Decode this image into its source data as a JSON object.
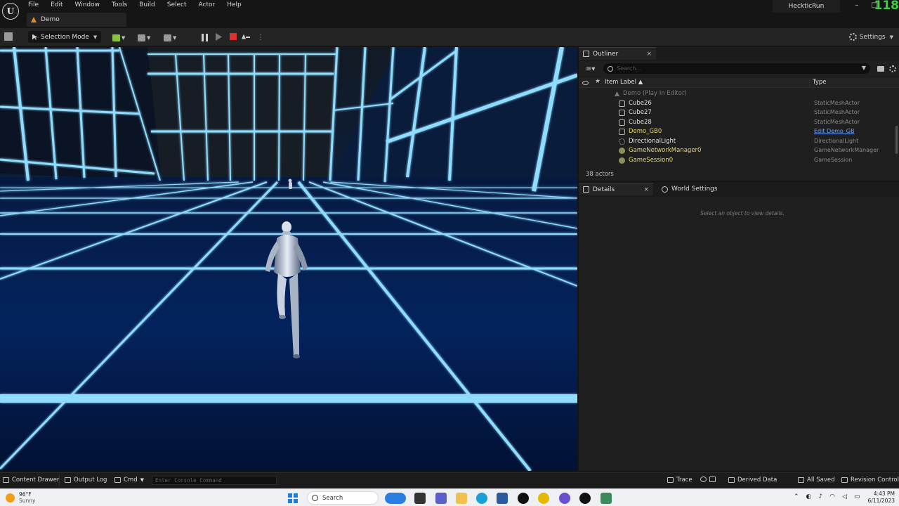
{
  "app": {
    "menu": [
      "File",
      "Edit",
      "Window",
      "Tools",
      "Build",
      "Select",
      "Actor",
      "Help"
    ],
    "level_tab": "Demo",
    "project_name": "HeckticRun",
    "fps_overlay": "118"
  },
  "toolbar": {
    "selection_mode": "Selection Mode",
    "settings_label": "Settings"
  },
  "outliner": {
    "tab_label": "Outliner",
    "search_placeholder": "Search...",
    "col_item_label": "Item Label",
    "sort_indicator": "▲",
    "col_type": "Type",
    "rows": [
      {
        "name": "Demo (Play In Editor)",
        "type": ""
      },
      {
        "name": "Cube26",
        "type": "StaticMeshActor"
      },
      {
        "name": "Cube27",
        "type": "StaticMeshActor"
      },
      {
        "name": "Cube28",
        "type": "StaticMeshActor"
      },
      {
        "name": "Demo_GB0",
        "type": "Edit Demo_GB"
      },
      {
        "name": "DirectionalLight",
        "type": "DirectionalLight"
      },
      {
        "name": "GameNetworkManager0",
        "type": "GameNetworkManager"
      },
      {
        "name": "GameSession0",
        "type": "GameSession"
      }
    ],
    "actor_count": "38 actors"
  },
  "details": {
    "tab_label": "Details",
    "world_settings_label": "World Settings",
    "empty_message": "Select an object to view details."
  },
  "statusbar": {
    "content_drawer": "Content Drawer",
    "output_log": "Output Log",
    "cmd": "Cmd",
    "console_placeholder": "Enter Console Command",
    "trace": "Trace",
    "derived_data": "Derived Data",
    "all_saved": "All Saved",
    "revision_control": "Revision Control"
  },
  "taskbar": {
    "weather_temp": "96°F",
    "weather_cond": "Sunny",
    "search_label": "Search",
    "time": "4:43 PM",
    "date": "6/11/2023"
  },
  "colors": {
    "accent_play_stop": "#e03030",
    "neon_grid": "#7fd8ff",
    "fps_green": "#3fd13f",
    "link_blue": "#6ea2ff"
  }
}
